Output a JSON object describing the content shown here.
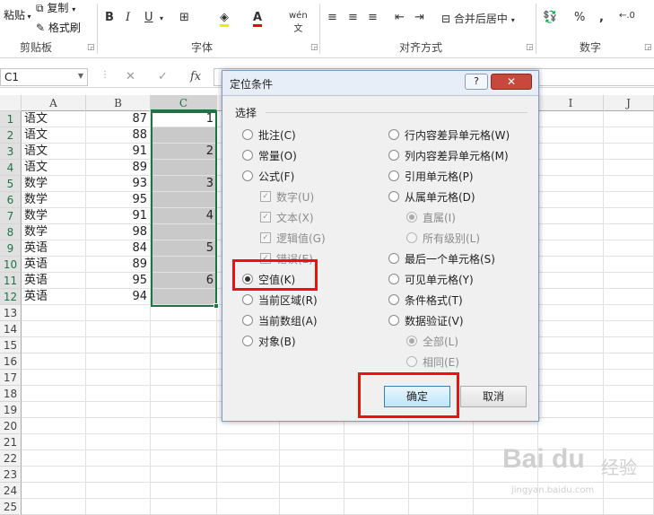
{
  "ribbon": {
    "paste_label": "粘贴",
    "copy_label": "复制",
    "copy_dropdown": "▾",
    "format_painter_label": "格式刷",
    "clipboard_group": "剪贴板",
    "font_group": "字体",
    "align_group": "对齐方式",
    "number_group": "数字",
    "merge_label": "合并后居中",
    "percent": "%",
    "comma": ","
  },
  "formula_bar": {
    "name_box": "C1",
    "cancel": "✕",
    "enter": "✓",
    "fx": "fx"
  },
  "columns": [
    "A",
    "B",
    "C",
    "I",
    "J"
  ],
  "rows": [
    {
      "num": "1",
      "a": "语文",
      "b": "87",
      "c": "1"
    },
    {
      "num": "2",
      "a": "语文",
      "b": "88",
      "c": ""
    },
    {
      "num": "3",
      "a": "语文",
      "b": "91",
      "c": "2"
    },
    {
      "num": "4",
      "a": "语文",
      "b": "89",
      "c": ""
    },
    {
      "num": "5",
      "a": "数学",
      "b": "93",
      "c": "3"
    },
    {
      "num": "6",
      "a": "数学",
      "b": "95",
      "c": ""
    },
    {
      "num": "7",
      "a": "数学",
      "b": "91",
      "c": "4"
    },
    {
      "num": "8",
      "a": "数学",
      "b": "98",
      "c": ""
    },
    {
      "num": "9",
      "a": "英语",
      "b": "84",
      "c": "5"
    },
    {
      "num": "10",
      "a": "英语",
      "b": "89",
      "c": ""
    },
    {
      "num": "11",
      "a": "英语",
      "b": "95",
      "c": "6"
    },
    {
      "num": "12",
      "a": "英语",
      "b": "94",
      "c": ""
    }
  ],
  "empty_rows": [
    "13",
    "14",
    "15",
    "16",
    "17",
    "18",
    "19",
    "20",
    "21",
    "22",
    "23",
    "24",
    "25"
  ],
  "dialog": {
    "title": "定位条件",
    "help": "?",
    "close": "✕",
    "group_label": "选择",
    "left_options": [
      {
        "label": "批注(C)",
        "type": "radio",
        "checked": false,
        "disabled": false
      },
      {
        "label": "常量(O)",
        "type": "radio",
        "checked": false,
        "disabled": false
      },
      {
        "label": "公式(F)",
        "type": "radio",
        "checked": false,
        "disabled": false
      },
      {
        "label": "数字(U)",
        "type": "check",
        "checked": true,
        "disabled": true
      },
      {
        "label": "文本(X)",
        "type": "check",
        "checked": true,
        "disabled": true
      },
      {
        "label": "逻辑值(G)",
        "type": "check",
        "checked": true,
        "disabled": true
      },
      {
        "label": "错误(E)",
        "type": "check",
        "checked": true,
        "disabled": true
      },
      {
        "label": "空值(K)",
        "type": "radio",
        "checked": true,
        "disabled": false
      },
      {
        "label": "当前区域(R)",
        "type": "radio",
        "checked": false,
        "disabled": false
      },
      {
        "label": "当前数组(A)",
        "type": "radio",
        "checked": false,
        "disabled": false
      },
      {
        "label": "对象(B)",
        "type": "radio",
        "checked": false,
        "disabled": false
      }
    ],
    "right_options": [
      {
        "label": "行内容差异单元格(W)",
        "type": "radio",
        "checked": false,
        "disabled": false
      },
      {
        "label": "列内容差异单元格(M)",
        "type": "radio",
        "checked": false,
        "disabled": false
      },
      {
        "label": "引用单元格(P)",
        "type": "radio",
        "checked": false,
        "disabled": false
      },
      {
        "label": "从属单元格(D)",
        "type": "radio",
        "checked": false,
        "disabled": false
      },
      {
        "label": "直属(I)",
        "type": "radio",
        "checked": true,
        "disabled": true
      },
      {
        "label": "所有级别(L)",
        "type": "radio",
        "checked": false,
        "disabled": true
      },
      {
        "label": "最后一个单元格(S)",
        "type": "radio",
        "checked": false,
        "disabled": false
      },
      {
        "label": "可见单元格(Y)",
        "type": "radio",
        "checked": false,
        "disabled": false
      },
      {
        "label": "条件格式(T)",
        "type": "radio",
        "checked": false,
        "disabled": false
      },
      {
        "label": "数据验证(V)",
        "type": "radio",
        "checked": false,
        "disabled": false
      },
      {
        "label": "全部(L)",
        "type": "radio",
        "checked": true,
        "disabled": true
      },
      {
        "label": "相同(E)",
        "type": "radio",
        "checked": false,
        "disabled": true
      }
    ],
    "ok_label": "确定",
    "cancel_label": "取消"
  },
  "watermark": {
    "logo": "Bai du",
    "cn": "经验",
    "url": "jingyan.baidu.com"
  }
}
